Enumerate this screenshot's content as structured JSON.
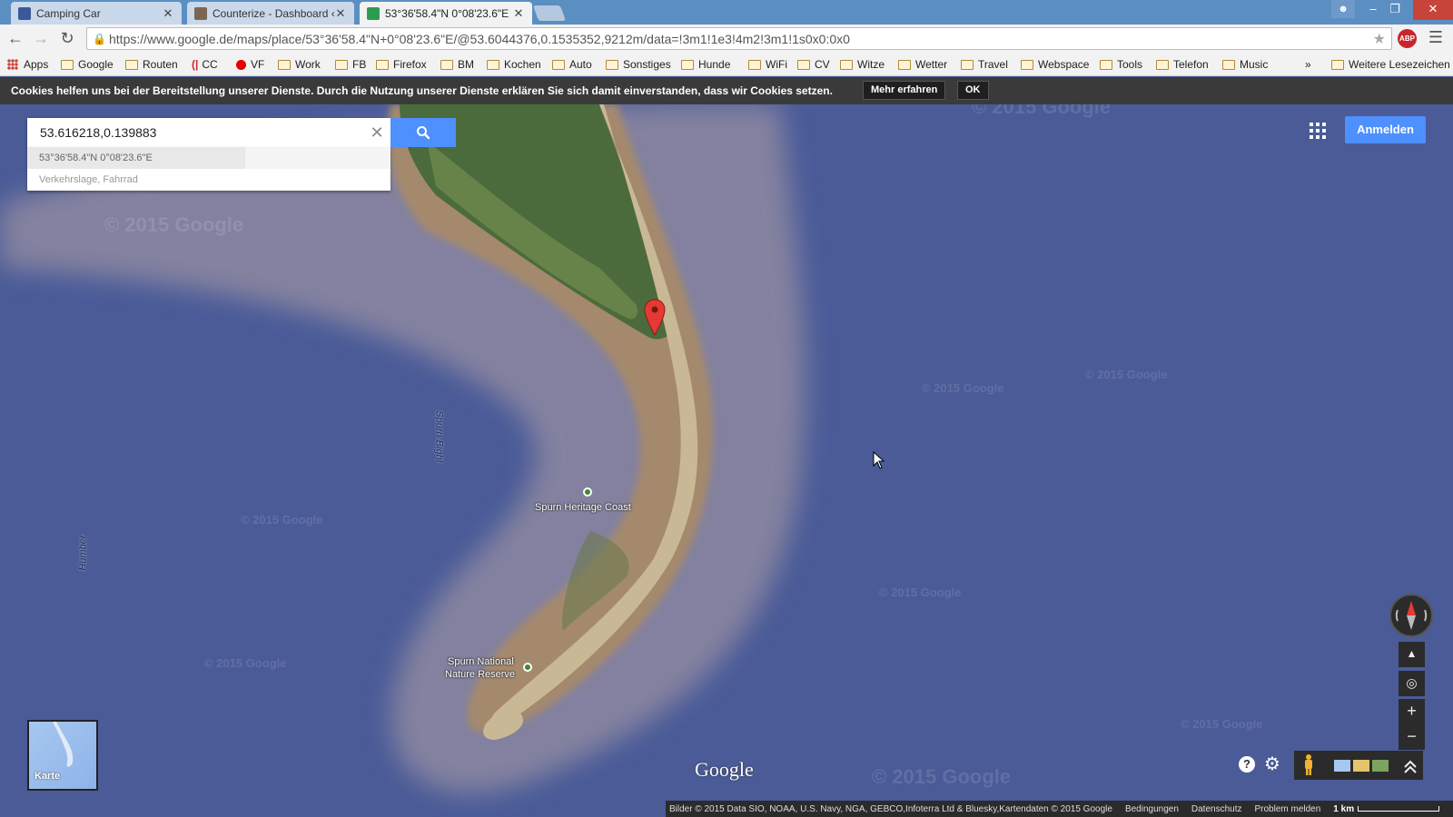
{
  "tabs": [
    {
      "title": "Camping Car",
      "favicon_color": "#3b5998"
    },
    {
      "title": "Counterize - Dashboard ‹",
      "favicon_color": "#7a6652"
    },
    {
      "title": "53°36'58.4\"N 0°08'23.6\"E",
      "favicon_color": "#2e9c4f"
    }
  ],
  "window_controls": {
    "minimize": "–",
    "maximize": "❐",
    "close": "✕"
  },
  "address_bar": {
    "url": "https://www.google.de/maps/place/53°36'58.4\"N+0°08'23.6\"E/@53.6044376,0.1535352,9212m/data=!3m1!1e3!4m2!3m1!1s0x0:0x0"
  },
  "bookmarks": [
    {
      "label": "Apps",
      "icon": "apps-grid"
    },
    {
      "label": "Google",
      "icon": "folder"
    },
    {
      "label": "Routen",
      "icon": "folder"
    },
    {
      "label": "CC",
      "icon": "cc-logo"
    },
    {
      "label": "VF",
      "icon": "vodafone-logo"
    },
    {
      "label": "Work",
      "icon": "folder"
    },
    {
      "label": "FB",
      "icon": "folder"
    },
    {
      "label": "Firefox",
      "icon": "folder"
    },
    {
      "label": "BM",
      "icon": "folder"
    },
    {
      "label": "Kochen",
      "icon": "folder"
    },
    {
      "label": "Auto",
      "icon": "folder"
    },
    {
      "label": "Sonstiges",
      "icon": "folder"
    },
    {
      "label": "Hunde",
      "icon": "folder"
    },
    {
      "label": "WiFi",
      "icon": "folder"
    },
    {
      "label": "CV",
      "icon": "folder"
    },
    {
      "label": "Witze",
      "icon": "folder"
    },
    {
      "label": "Wetter",
      "icon": "folder"
    },
    {
      "label": "Travel",
      "icon": "folder"
    },
    {
      "label": "Webspace",
      "icon": "folder"
    },
    {
      "label": "Tools",
      "icon": "folder"
    },
    {
      "label": "Telefon",
      "icon": "folder"
    },
    {
      "label": "Music",
      "icon": "folder"
    }
  ],
  "bookmarks_overflow": "»",
  "other_bookmarks": "Weitere Lesezeichen",
  "cookie_bar": {
    "text": "Cookies helfen uns bei der Bereitstellung unserer Dienste. Durch die Nutzung unserer Dienste erklären Sie sich damit einverstanden, dass wir Cookies setzen.",
    "more_label": "Mehr erfahren",
    "ok_label": "OK"
  },
  "search": {
    "value": "53.616218,0.139883",
    "suggestions": [
      "53°36'58.4\"N 0°08'23.6\"E",
      "Verkehrslage, Fahrrad"
    ]
  },
  "signin_label": "Anmelden",
  "map": {
    "labels": {
      "spurn_heritage": "Spurn Heritage Coast",
      "spurn_nature_line1": "Spurn National",
      "spurn_nature_line2": "Nature Reserve",
      "spurn_bight": "Spurn Bight",
      "humber": "Humber"
    },
    "watermark": "© 2015 Google",
    "thumbnail_label": "Karte",
    "logo": "Google"
  },
  "zoom_in": "+",
  "zoom_out": "−",
  "footer": {
    "attribution": "Bilder © 2015 Data SIO, NOAA, U.S. Navy, NGA, GEBCO,Infoterra Ltd & Bluesky,Kartendaten © 2015 Google",
    "terms": "Bedingungen",
    "privacy": "Datenschutz",
    "report": "Problem melden",
    "scale": "1 km"
  },
  "colors": {
    "accent": "#4d90fe",
    "water": "#4a5b98",
    "sand": "#a88f6e",
    "marker": "#e53935"
  }
}
